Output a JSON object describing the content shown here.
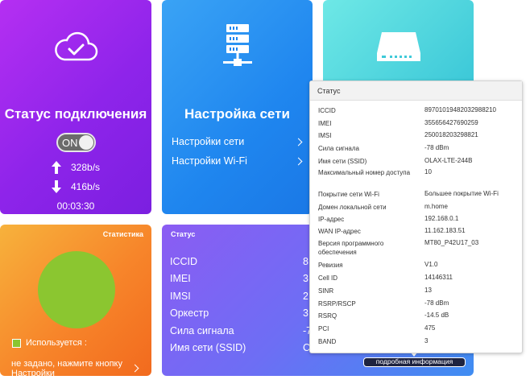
{
  "connection": {
    "title": "Статус подключения",
    "toggle_label": "ON",
    "upload_rate": "328b/s",
    "download_rate": "416b/s",
    "duration": "00:03:30"
  },
  "network": {
    "title": "Настройка сети",
    "links": [
      "Настройки сети",
      "Настройки Wi-Fi"
    ]
  },
  "stats": {
    "title": "Статистика",
    "legend_label": "Используется :",
    "hint": "не задано, нажмите кнопку Настройки"
  },
  "status": {
    "title": "Статус",
    "rows": [
      {
        "label": "ICCID",
        "value": "8"
      },
      {
        "label": "IMEI",
        "value": "3"
      },
      {
        "label": "IMSI",
        "value": "2"
      },
      {
        "label": "Оркестр",
        "value": "3"
      },
      {
        "label": "Сила сигнала",
        "value": "-7"
      },
      {
        "label": "Имя сети (SSID)",
        "value": "C"
      }
    ],
    "more_button": "подробная информация"
  },
  "popup": {
    "title": "Статус",
    "rows": [
      {
        "label": "ICCID",
        "value": "89701019482032988210"
      },
      {
        "label": "IMEI",
        "value": "355656427690259"
      },
      {
        "label": "IMSI",
        "value": "250018203298821"
      },
      {
        "label": "Сила сигнала",
        "value": "-78 dBm"
      },
      {
        "label": "Имя сети (SSID)",
        "value": "OLAX-LTE-244B"
      },
      {
        "label": "Максимальный номер доступа",
        "value": "10"
      },
      {
        "label": "Покрытие сети Wi-Fi",
        "value": "Большее покрытие Wi-Fi"
      },
      {
        "label": "Домен локальной сети",
        "value": "m.home"
      },
      {
        "label": "IP-адрес",
        "value": "192.168.0.1"
      },
      {
        "label": "WAN IP-адрес",
        "value": "11.162.183.51"
      },
      {
        "label": "Версия программного обеспечения",
        "value": "MT80_P42U17_03"
      },
      {
        "label": "Ревизия",
        "value": "V1.0"
      },
      {
        "label": "Cell ID",
        "value": "14146311"
      },
      {
        "label": "SINR",
        "value": "13"
      },
      {
        "label": "RSRP/RSCP",
        "value": "-78 dBm"
      },
      {
        "label": "RSRQ",
        "value": "-14.5 dB"
      },
      {
        "label": "PCI",
        "value": "475"
      },
      {
        "label": "BAND",
        "value": "3"
      }
    ]
  },
  "colors": {
    "connection_tile": "#9b27ee",
    "network_tile": "#1f86ef",
    "device_tile": "#3fcad9",
    "stats_tile": "#f7852a",
    "status_tile": "#6d6ef4",
    "pie_used": "#8bc630"
  }
}
